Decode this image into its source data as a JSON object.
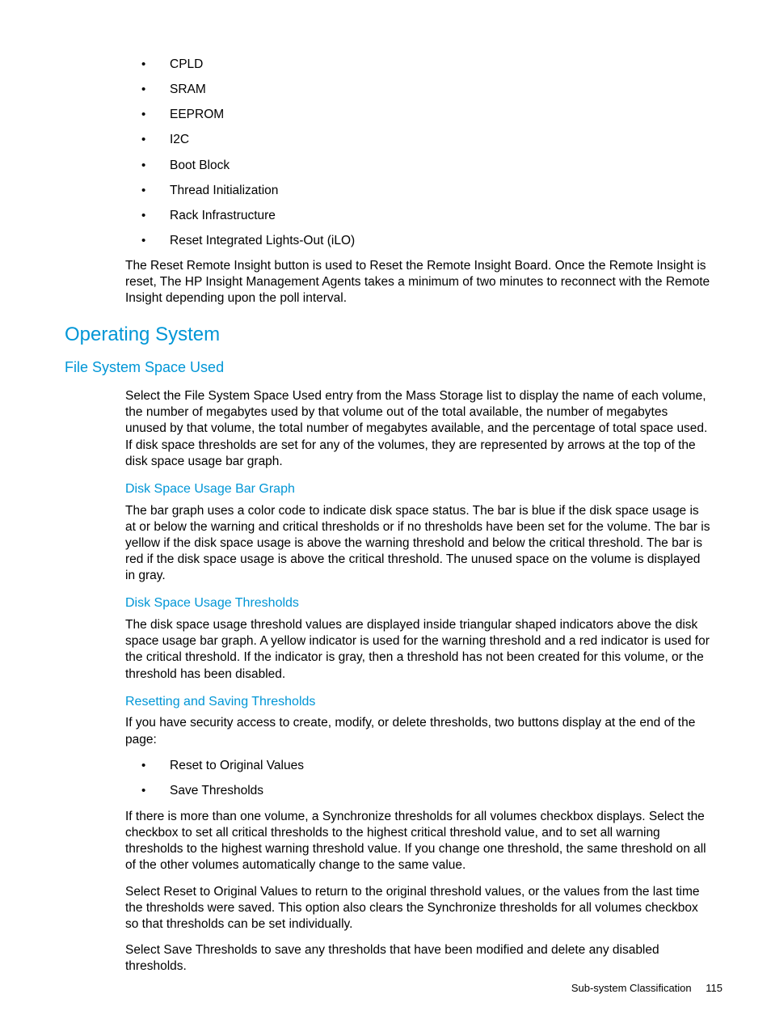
{
  "top_list": [
    "CPLD",
    "SRAM",
    "EEPROM",
    "I2C",
    "Boot Block",
    "Thread Initialization",
    "Rack Infrastructure",
    "Reset Integrated Lights-Out (iLO)"
  ],
  "para1": "The Reset Remote Insight button is used to Reset the Remote Insight Board.  Once the Remote Insight is reset, The HP Insight Management Agents takes a minimum of two minutes to reconnect with the Remote Insight depending upon the poll interval.",
  "h2": "Operating System",
  "h3": "File System Space Used",
  "para2": "Select the File System Space Used entry from the Mass Storage list to display the name of each volume, the number of megabytes used by that volume out of the total available, the number of megabytes unused by that volume, the total number of megabytes available, and the percentage of total space used. If disk space thresholds are set for any of the volumes, they are represented by arrows at the top of the disk space usage bar graph.",
  "h4a": "Disk Space Usage Bar Graph",
  "para3": "The bar graph uses a color code to indicate disk space status. The bar is blue if the disk space usage is at or below the warning and critical thresholds or if no thresholds have been set for the volume. The bar is yellow if the disk space usage is above the warning threshold and below the critical threshold. The bar is red if the disk space usage is above the critical threshold. The unused space on the volume is displayed in gray.",
  "h4b": "Disk Space Usage Thresholds",
  "para4": "The disk space usage threshold values are displayed inside triangular shaped indicators above the disk space usage bar graph. A yellow indicator is used for the warning threshold and a red indicator is used for the critical threshold. If the indicator is gray, then a threshold has not been created for this volume, or the threshold has been disabled.",
  "h4c": "Resetting and Saving Thresholds",
  "para5": "If you have security access to create, modify, or delete thresholds, two buttons display at the end of the page:",
  "mid_list": [
    "Reset to Original Values",
    "Save Thresholds"
  ],
  "para6": "If there is more than one volume, a Synchronize thresholds for all volumes checkbox displays. Select the checkbox to set all critical thresholds to the highest critical threshold value, and to set all warning thresholds to the highest warning threshold value. If you change one threshold, the same threshold on all of the other volumes automatically change to the same value.",
  "para7": "Select Reset to Original Values to return to the original threshold values, or the values from the last time the thresholds were saved. This option also clears the Synchronize thresholds for all volumes checkbox so that thresholds can be set individually.",
  "para8": "Select Save Thresholds to save any thresholds that have been modified and delete any disabled thresholds.",
  "footer_text": "Sub-system Classification",
  "page_num": "115"
}
